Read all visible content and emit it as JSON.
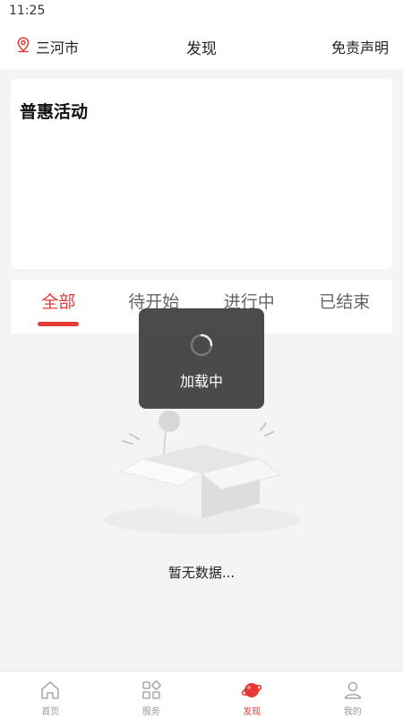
{
  "status_bar": {
    "time": "11:25"
  },
  "header": {
    "city": "三河市",
    "title": "发现",
    "disclaimer": "免责声明"
  },
  "promo": {
    "title": "普惠活动"
  },
  "tabs": [
    {
      "label": "全部",
      "active": true
    },
    {
      "label": "待开始",
      "active": false
    },
    {
      "label": "进行中",
      "active": false
    },
    {
      "label": "已结束",
      "active": false
    }
  ],
  "empty_state": {
    "text": "暂无数据..."
  },
  "loading": {
    "text": "加载中"
  },
  "bottom_nav": [
    {
      "label": "首页",
      "icon": "home-icon"
    },
    {
      "label": "服务",
      "icon": "grid-icon"
    },
    {
      "label": "发现",
      "icon": "planet-icon",
      "active": true
    },
    {
      "label": "我的",
      "icon": "user-icon"
    }
  ],
  "colors": {
    "accent": "#e53935",
    "background": "#f4f4f4",
    "toast": "#373737"
  }
}
